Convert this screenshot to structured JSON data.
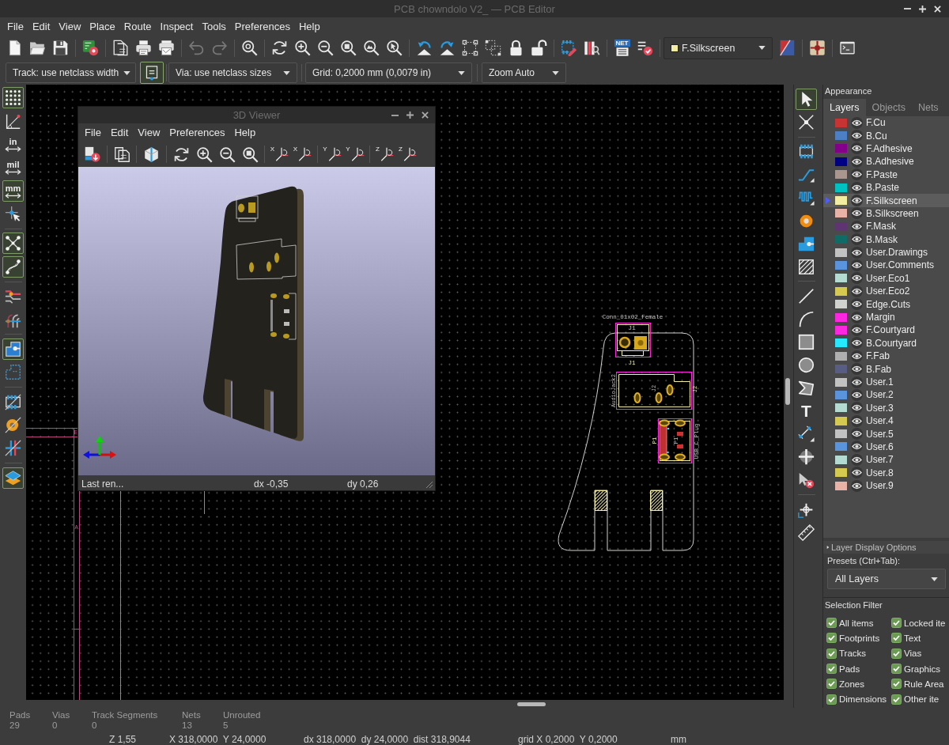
{
  "window": {
    "title": "PCB chowndolo V2_ — PCB Editor"
  },
  "menu": [
    "File",
    "Edit",
    "View",
    "Place",
    "Route",
    "Inspect",
    "Tools",
    "Preferences",
    "Help"
  ],
  "main_toolbar": {
    "left_groups": [
      [
        {
          "disabled": false
        },
        {
          "disabled": false
        },
        {
          "disabled": false
        }
      ],
      [
        {
          "disabled": false
        }
      ],
      [
        {
          "disabled": false
        },
        {
          "disabled": false
        },
        {
          "disabled": false
        }
      ],
      [
        {
          "disabled": true
        },
        {
          "disabled": true
        }
      ],
      [
        {
          "disabled": false
        }
      ],
      [
        {
          "disabled": false
        },
        {
          "disabled": false
        },
        {
          "disabled": false
        },
        {
          "disabled": false
        },
        {
          "disabled": false
        },
        {
          "disabled": false
        }
      ],
      [
        {
          "disabled": false
        },
        {
          "disabled": false
        },
        {
          "disabled": false
        },
        {
          "disabled": false
        },
        {
          "disabled": false
        },
        {
          "disabled": false
        }
      ],
      [
        {
          "disabled": false
        },
        {
          "disabled": false
        }
      ],
      [
        {
          "disabled": false,
          "label": "NET"
        },
        {
          "disabled": false
        }
      ]
    ],
    "layer_select": "F.Silkscreen",
    "right_groups": [
      [
        {
          "disabled": false
        }
      ],
      [
        {
          "disabled": false
        }
      ],
      [
        {
          "disabled": false
        }
      ]
    ]
  },
  "options_toolbar": {
    "track_width": "Track: use netclass width",
    "auto_track_width": {
      "active": true
    },
    "via_size": "Via: use netclass sizes",
    "grid": "Grid: 0,2000 mm (0,0079 in)",
    "zoom": "Zoom Auto"
  },
  "left_toolbar": [
    [
      {
        "active": true
      },
      {
        "active": false
      },
      {
        "label": "in",
        "active": false
      },
      {
        "label": "mil",
        "active": false
      },
      {
        "label": "mm",
        "active": true
      },
      {
        "active": false
      }
    ],
    [
      {
        "active": true
      },
      {
        "active": true
      }
    ],
    [
      {
        "active": false
      },
      {
        "active": false
      }
    ],
    [
      {
        "active": true
      },
      {
        "active": false
      }
    ],
    [
      {
        "active": false
      },
      {
        "active": false
      },
      {
        "active": false
      }
    ],
    [
      {
        "active": true
      }
    ]
  ],
  "right_toolbar": [
    [
      {
        "active": true
      },
      {
        "active": false
      }
    ],
    [
      {
        "active": false
      },
      {
        "active": false
      },
      {
        "active": false
      },
      {
        "active": false
      },
      {
        "active": false
      },
      {
        "active": false
      }
    ],
    [
      {
        "active": false
      },
      {
        "active": false
      },
      {
        "active": false
      },
      {
        "active": false
      },
      {
        "active": false
      },
      {
        "active": false,
        "label": "T"
      },
      {
        "active": false
      },
      {
        "active": false
      },
      {
        "active": false
      }
    ],
    [
      {
        "active": false
      },
      {
        "active": false
      }
    ]
  ],
  "canvas": {
    "frame_labels": [
      "E",
      "A"
    ],
    "board_texts": [
      "Conn_01x02_Female",
      "J1",
      "J1",
      "AudioJack2",
      "J2",
      "J2",
      "P1",
      "P1",
      "USB_C_Plug"
    ]
  },
  "viewer_3d": {
    "title": "3D Viewer",
    "menu": [
      "File",
      "Edit",
      "View",
      "Preferences",
      "Help"
    ],
    "axis_labels": [
      "X",
      "X",
      "Y",
      "Y",
      "Z",
      "Z"
    ],
    "status": [
      "Last ren...",
      "dx -0,35",
      "dy 0,26"
    ]
  },
  "appearance": {
    "title": "Appearance",
    "tabs": [
      {
        "label": "Layers",
        "selected": true
      },
      {
        "label": "Objects",
        "selected": false
      },
      {
        "label": "Nets",
        "selected": false
      }
    ],
    "layers": [
      {
        "name": "F.Cu",
        "color": "#c83434",
        "visible": true,
        "selected": false
      },
      {
        "name": "B.Cu",
        "color": "#4d7fc4",
        "visible": true,
        "selected": false
      },
      {
        "name": "F.Adhesive",
        "color": "#84008a",
        "visible": true,
        "selected": false
      },
      {
        "name": "B.Adhesive",
        "color": "#000084",
        "visible": true,
        "selected": false
      },
      {
        "name": "F.Paste",
        "color": "#a8968f",
        "visible": true,
        "selected": false
      },
      {
        "name": "B.Paste",
        "color": "#00c2c2",
        "visible": true,
        "selected": false
      },
      {
        "name": "F.Silkscreen",
        "color": "#f2eda1",
        "visible": true,
        "selected": true
      },
      {
        "name": "B.Silkscreen",
        "color": "#e8b2a7",
        "visible": true,
        "selected": false
      },
      {
        "name": "F.Mask",
        "color": "#5e3572",
        "visible": true,
        "selected": false
      },
      {
        "name": "B.Mask",
        "color": "#0e6b66",
        "visible": true,
        "selected": false
      },
      {
        "name": "User.Drawings",
        "color": "#c2c2c2",
        "visible": true,
        "selected": false
      },
      {
        "name": "User.Comments",
        "color": "#5994dc",
        "visible": true,
        "selected": false
      },
      {
        "name": "User.Eco1",
        "color": "#b4dbd2",
        "visible": true,
        "selected": false
      },
      {
        "name": "User.Eco2",
        "color": "#d6c950",
        "visible": true,
        "selected": false
      },
      {
        "name": "Edge.Cuts",
        "color": "#d0d2cd",
        "visible": true,
        "selected": false
      },
      {
        "name": "Margin",
        "color": "#ff26e2",
        "visible": true,
        "selected": false
      },
      {
        "name": "F.Courtyard",
        "color": "#ff26e2",
        "visible": true,
        "selected": false
      },
      {
        "name": "B.Courtyard",
        "color": "#26e9ff",
        "visible": true,
        "selected": false
      },
      {
        "name": "F.Fab",
        "color": "#afafaf",
        "visible": true,
        "selected": false
      },
      {
        "name": "B.Fab",
        "color": "#585d84",
        "visible": true,
        "selected": false
      },
      {
        "name": "User.1",
        "color": "#c2c2c2",
        "visible": true,
        "selected": false
      },
      {
        "name": "User.2",
        "color": "#5994dc",
        "visible": true,
        "selected": false
      },
      {
        "name": "User.3",
        "color": "#b4dbd2",
        "visible": true,
        "selected": false
      },
      {
        "name": "User.4",
        "color": "#d6c950",
        "visible": true,
        "selected": false
      },
      {
        "name": "User.5",
        "color": "#c2c2c2",
        "visible": true,
        "selected": false
      },
      {
        "name": "User.6",
        "color": "#5994dc",
        "visible": true,
        "selected": false
      },
      {
        "name": "User.7",
        "color": "#b4dbd2",
        "visible": true,
        "selected": false
      },
      {
        "name": "User.8",
        "color": "#d6c950",
        "visible": true,
        "selected": false
      },
      {
        "name": "User.9",
        "color": "#e8b2a7",
        "visible": true,
        "selected": false
      }
    ],
    "display_options": {
      "label": "Layer Display Options",
      "expanded": false
    },
    "presets_label": "Presets (Ctrl+Tab):",
    "preset": "All Layers"
  },
  "selection_filter": {
    "title": "Selection Filter",
    "items": [
      {
        "label": "All items",
        "checked": true
      },
      {
        "label": "Locked ite",
        "checked": true
      },
      {
        "label": "Footprints",
        "checked": true
      },
      {
        "label": "Text",
        "checked": true
      },
      {
        "label": "Tracks",
        "checked": true
      },
      {
        "label": "Vias",
        "checked": true
      },
      {
        "label": "Pads",
        "checked": true
      },
      {
        "label": "Graphics",
        "checked": true
      },
      {
        "label": "Zones",
        "checked": true
      },
      {
        "label": "Rule Area",
        "checked": true
      },
      {
        "label": "Dimensions",
        "checked": true
      },
      {
        "label": "Other ite",
        "checked": true
      }
    ]
  },
  "messages": [
    {
      "label": "Pads",
      "value": "29"
    },
    {
      "label": "Vias",
      "value": "0"
    },
    {
      "label": "Track Segments",
      "value": "0"
    },
    {
      "label": "Nets",
      "value": "13"
    },
    {
      "label": "Unrouted",
      "value": "5"
    }
  ],
  "status_bar": [
    "Z 1,55",
    "X 318,0000  Y 24,0000",
    "dx 318,0000  dy 24,0000  dist 318,9044",
    "grid X 0,2000  Y 0,2000",
    "mm"
  ]
}
